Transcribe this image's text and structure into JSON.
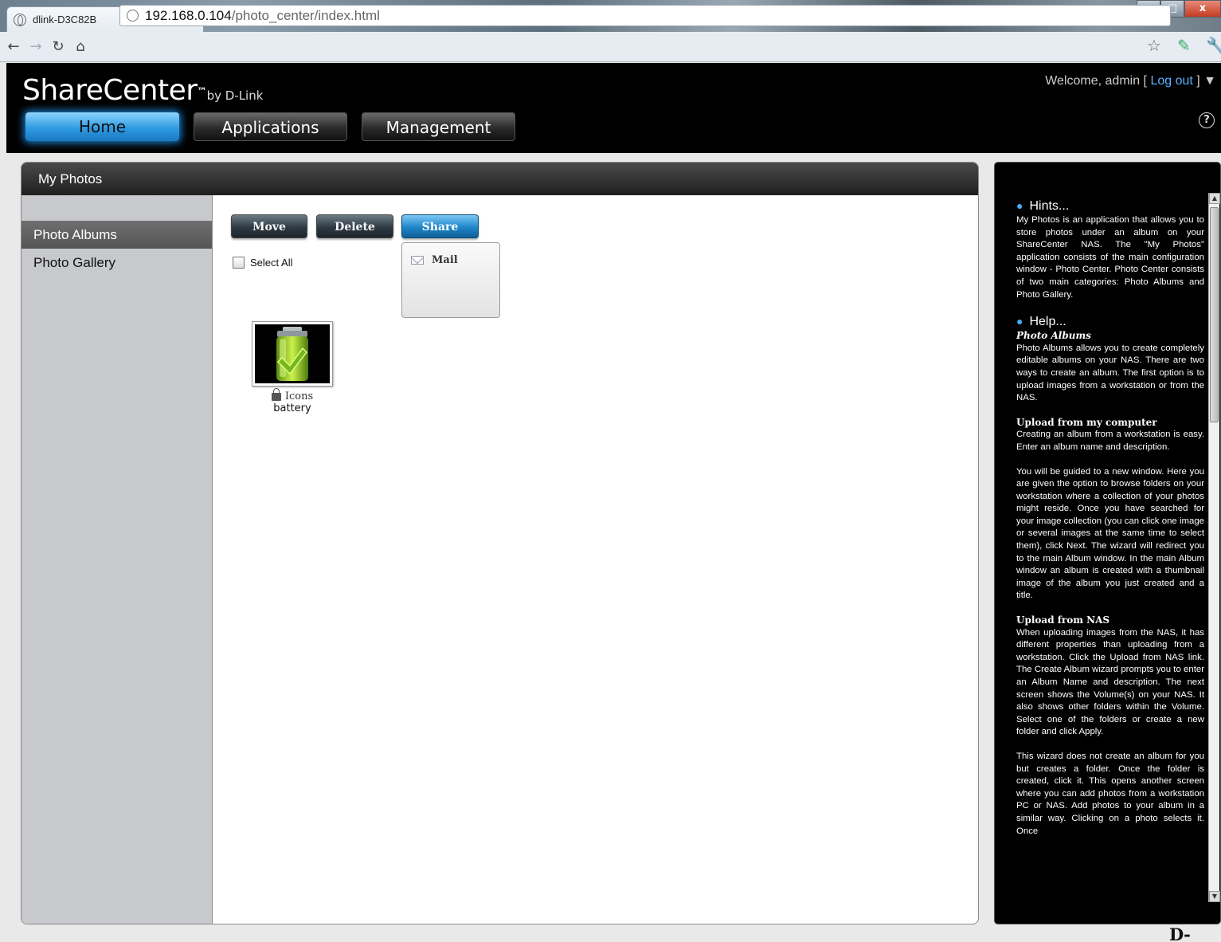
{
  "browser": {
    "tab_title": "dlink-D3C82B",
    "tab_close": "×",
    "new_tab": "+",
    "url_host": "192.168.0.104",
    "url_path": "/photo_center/index.html",
    "controls": {
      "minimize": "–",
      "maximize": "□",
      "close": "x"
    }
  },
  "header": {
    "brand": "ShareCenter",
    "tm": "™",
    "by": "by D-Link",
    "nav": {
      "home": "Home",
      "applications": "Applications",
      "management": "Management"
    },
    "welcome_prefix": "Welcome, admin [ ",
    "logout": "Log out",
    "welcome_suffix": " ] ▼",
    "help": "?"
  },
  "panel": {
    "title": "My Photos",
    "sidebar": {
      "albums": "Photo Albums",
      "gallery": "Photo Gallery"
    },
    "toolbar": {
      "move": "Move",
      "delete": "Delete",
      "share": "Share"
    },
    "select_all": "Select All",
    "share_menu": {
      "mail": "Mail"
    },
    "album": {
      "type_label": "Icons",
      "name": "battery"
    }
  },
  "hints": {
    "hints_title": "Hints...",
    "hints_body": "My Photos is an application that allows you to store photos under an album on your ShareCenter NAS. The \"My Photos\" application consists of the main configuration window - Photo Center. Photo Center consists of two main categories: Photo Albums and Photo Gallery.",
    "help_title": "Help...",
    "photo_albums_title": "Photo Albums",
    "photo_albums_body": "Photo Albums allows you to create completely editable albums on your NAS. There are two ways to create an album. The first option is to upload images from a workstation or from the NAS.",
    "upload_computer_title": "Upload from my computer",
    "upload_computer_body": "Creating an album from a workstation is easy. Enter an album name and description.",
    "guided_body": "You will be guided to a new window. Here you are given the option to browse folders on your workstation where a collection of your photos might reside. Once you have searched for your image collection (you can click one image or several images at the same time to select them), click Next. The wizard will redirect you to the main Album window. In the main Album window an album is created with a thumbnail image of the album you just created and a title.",
    "upload_nas_title": "Upload from NAS",
    "upload_nas_body": "When uploading images from the NAS, it has different properties than uploading from a workstation. Click the Upload from NAS link. The Create Album wizard prompts you to enter an Album Name and description. The next screen shows the Volume(s) on your NAS. It also shows other folders within the Volume. Select one of the folders or create a new folder and click Apply.",
    "wizard_body": "This wizard does not create an album for you but creates a folder. Once the folder is created, click it. This opens another screen where you can add photos from a workstation PC or NAS. Add photos to your album in a similar way. Clicking on a photo selects it. Once"
  },
  "footer": {
    "logo": "D-Link"
  },
  "colors": {
    "accent_blue": "#1f86d8",
    "header_bg": "#000000",
    "sidebar_bg": "#c7c9cc"
  }
}
